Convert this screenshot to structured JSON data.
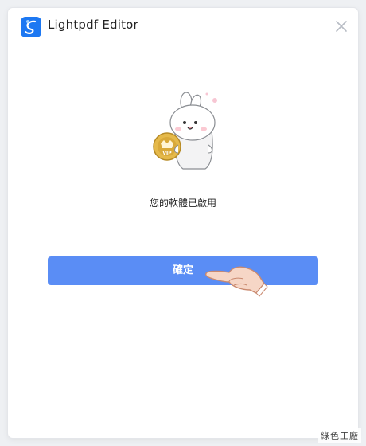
{
  "window": {
    "title": "Lightpdf Editor"
  },
  "icons": {
    "app_logo": "lightpdf-logo-icon",
    "close": "close-icon",
    "mascot": "vip-bunny-mascot-icon",
    "hand": "pointing-hand-icon"
  },
  "content": {
    "message": "您的軟體已啟用",
    "confirm_label": "確定"
  },
  "watermark": {
    "text": "綠色工廠"
  },
  "colors": {
    "primary": "#5a8df5",
    "logo": "#1d78f2",
    "vip_badge": "#d9a93a"
  }
}
